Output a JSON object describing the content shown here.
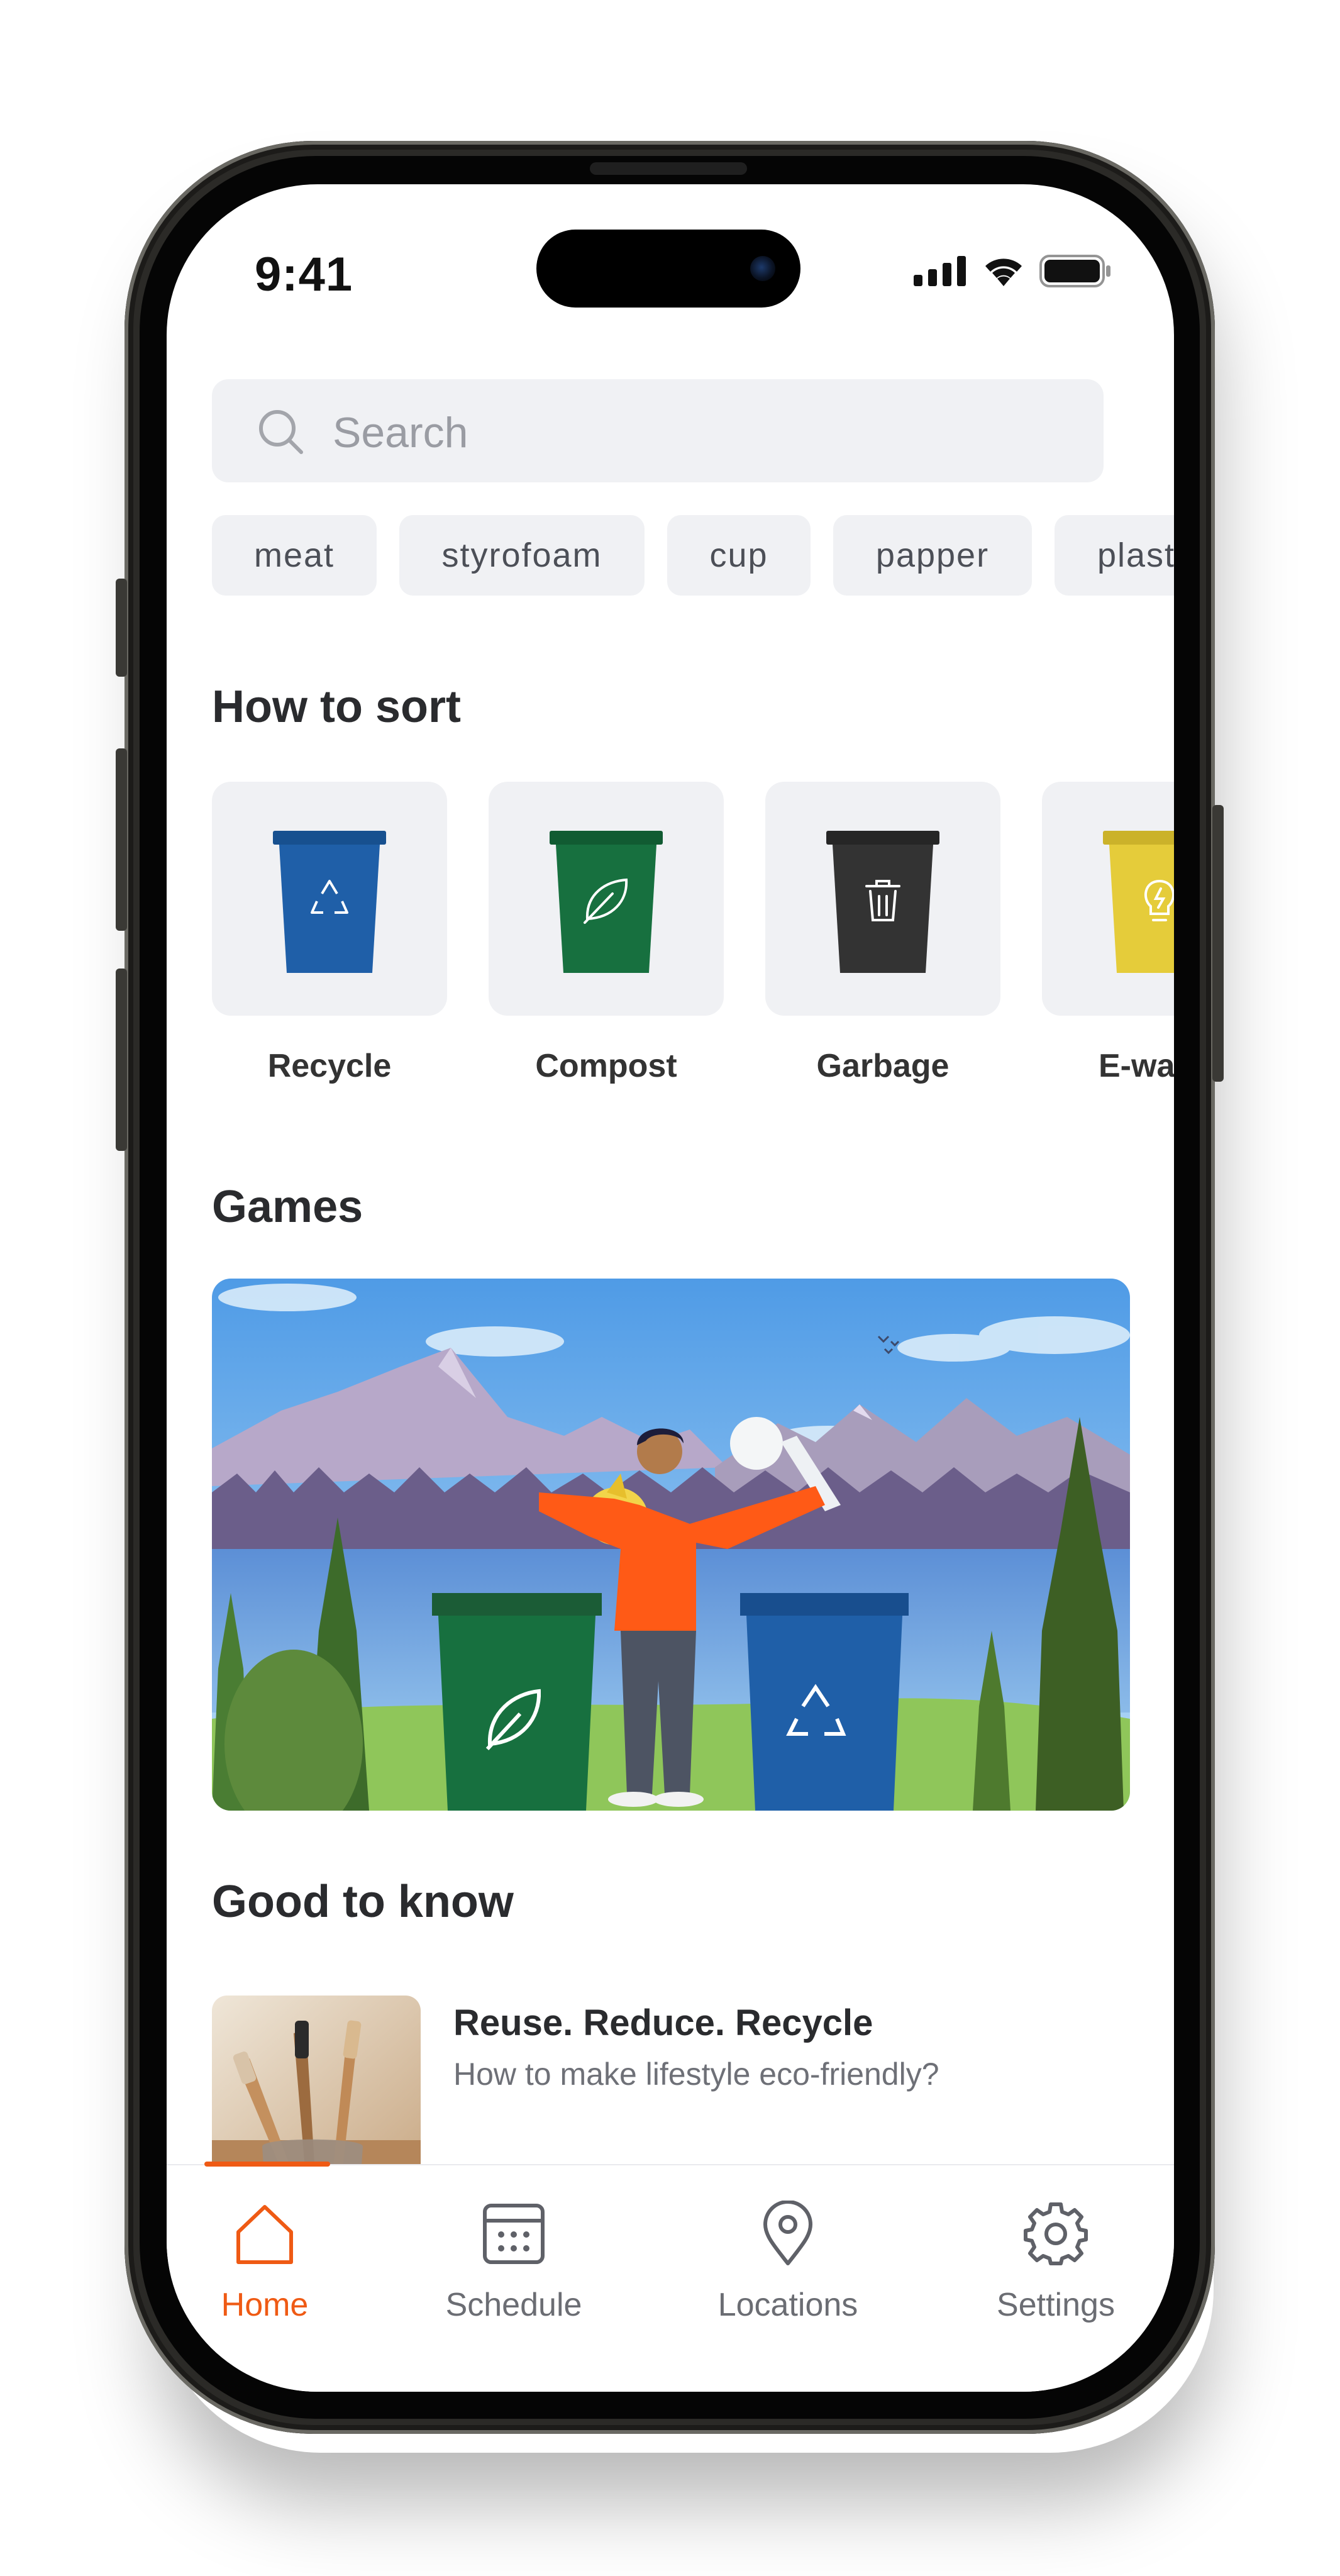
{
  "status_bar": {
    "time": "9:41"
  },
  "search": {
    "placeholder": "Search"
  },
  "chips": [
    "meat",
    "styrofoam",
    "cup",
    "papper",
    "plast"
  ],
  "how_to_sort": {
    "title": "How to sort",
    "items": [
      {
        "label": "Recycle",
        "color": "#1f5fa8",
        "icon": "recycle-icon"
      },
      {
        "label": "Compost",
        "color": "#17703f",
        "icon": "leaf-icon"
      },
      {
        "label": "Garbage",
        "color": "#333333",
        "icon": "trash-icon"
      },
      {
        "label": "E-wa",
        "color": "#e5cc3a",
        "icon": "lightbulb-icon"
      }
    ]
  },
  "games": {
    "title": "Games"
  },
  "good_to_know": {
    "title": "Good to know",
    "articles": [
      {
        "title": "Reuse. Reduce. Recycle",
        "subtitle": "How to make lifestyle eco-friendly?"
      }
    ]
  },
  "tab_bar": {
    "active": "Home",
    "accent": "#ef5a14",
    "tabs": [
      {
        "label": "Home",
        "icon": "home-icon"
      },
      {
        "label": "Schedule",
        "icon": "calendar-icon"
      },
      {
        "label": "Locations",
        "icon": "location-pin-icon"
      },
      {
        "label": "Settings",
        "icon": "gear-icon"
      }
    ]
  }
}
